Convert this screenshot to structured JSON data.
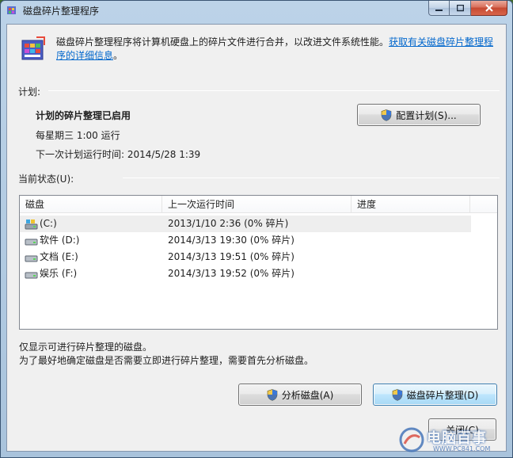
{
  "window": {
    "title": "磁盘碎片整理程序"
  },
  "header": {
    "description": "磁盘碎片整理程序将计算机硬盘上的碎片文件进行合并，以改进文件系统性能。",
    "link_text": "获取有关磁盘碎片整理程序的详细信息",
    "link_suffix": "。"
  },
  "schedule": {
    "section_label": "计划:",
    "status": "计划的碎片整理已启用",
    "frequency": "每星期三  1:00 运行",
    "next_run": "下一次计划运行时间: 2014/5/28 1:39",
    "configure_button": "配置计划(S)..."
  },
  "current_status": {
    "section_label": "当前状态(U):",
    "columns": [
      "磁盘",
      "上一次运行时间",
      "进度"
    ],
    "rows": [
      {
        "disk": "(C:)",
        "last_run": "2013/1/10 2:36 (0% 碎片)",
        "progress": "",
        "icon": "system-drive-icon"
      },
      {
        "disk": "软件 (D:)",
        "last_run": "2014/3/13 19:30 (0% 碎片)",
        "progress": "",
        "icon": "drive-icon"
      },
      {
        "disk": "文档 (E:)",
        "last_run": "2014/3/13 19:51 (0% 碎片)",
        "progress": "",
        "icon": "drive-icon"
      },
      {
        "disk": "娱乐 (F:)",
        "last_run": "2014/3/13 19:52 (0% 碎片)",
        "progress": "",
        "icon": "drive-icon"
      }
    ]
  },
  "notes": {
    "line1": "仅显示可进行碎片整理的磁盘。",
    "line2": "为了最好地确定磁盘是否需要立即进行碎片整理，需要首先分析磁盘。"
  },
  "actions": {
    "analyze_button": "分析磁盘(A)",
    "defrag_button": "磁盘碎片整理(D)",
    "close_button": "关闭(C)"
  },
  "watermark": {
    "text": "电脑百事",
    "url": "WWW.PC841.COM"
  },
  "colors": {
    "link": "#0066cc",
    "list_selection": "#eeeeee"
  }
}
